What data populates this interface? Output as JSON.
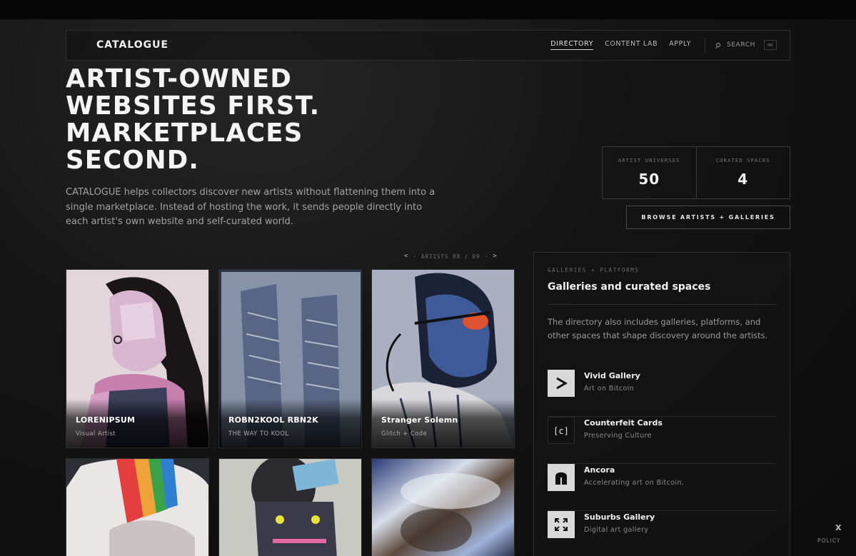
{
  "nav": {
    "logo": "CATALOGUE",
    "links": [
      {
        "label": "DIRECTORY",
        "active": true
      },
      {
        "label": "CONTENT LAB",
        "active": false
      },
      {
        "label": "APPLY",
        "active": false
      }
    ],
    "search_label": "SEARCH",
    "search_shortcut": "⌘K"
  },
  "hero": {
    "title_lines": [
      "ARTIST-OWNED",
      "WEBSITES FIRST.",
      "MARKETPLACES",
      "SECOND."
    ],
    "description": "CATALOGUE helps collectors discover new artists without flattening them into a single marketplace. Instead of hosting the work, it sends people directly into each artist's own website and self-curated world."
  },
  "stats": [
    {
      "label": "ARTIST UNIVERSES",
      "value": "50"
    },
    {
      "label": "CURATED SPACES",
      "value": "4"
    }
  ],
  "browse_button": "BROWSE ARTISTS + GALLERIES",
  "pager": {
    "prev": "<",
    "sep": "·",
    "label": "ARTISTS 08 / 09",
    "next": ">"
  },
  "artists": [
    {
      "name": "LORENIPSUM",
      "subtitle": "Visual Artist"
    },
    {
      "name": "ROBN2KOOL RBN2K",
      "subtitle": "THE WAY TO KOOL"
    },
    {
      "name": "Stranger Solemn",
      "subtitle": "Glitch + Code"
    }
  ],
  "panel": {
    "kicker": "GALLERIES + PLATFORMS",
    "title": "Galleries and curated spaces",
    "description": "The directory also includes galleries, platforms, and other spaces that shape discovery around the artists.",
    "galleries": [
      {
        "name": "Vivid Gallery",
        "subtitle": "Art on Bitcoin",
        "icon": "chevron-right-icon"
      },
      {
        "name": "Counterfeit Cards",
        "subtitle": "Preserving Culture",
        "icon": "bracket-c-icon"
      },
      {
        "name": "Ancora",
        "subtitle": "Accelerating art on Bitcoin.",
        "icon": "ancora-logo-icon"
      },
      {
        "name": "Suburbs Gallery",
        "subtitle": "Digital art gallery",
        "icon": "expand-arrows-icon"
      }
    ]
  },
  "footer": {
    "x_label": "X",
    "policy_label": "POLICY"
  },
  "colors": {
    "background": "#0d0d0d",
    "text": "#f4f4f4",
    "muted": "#9a9a9a",
    "border": "#2f2f2f"
  }
}
